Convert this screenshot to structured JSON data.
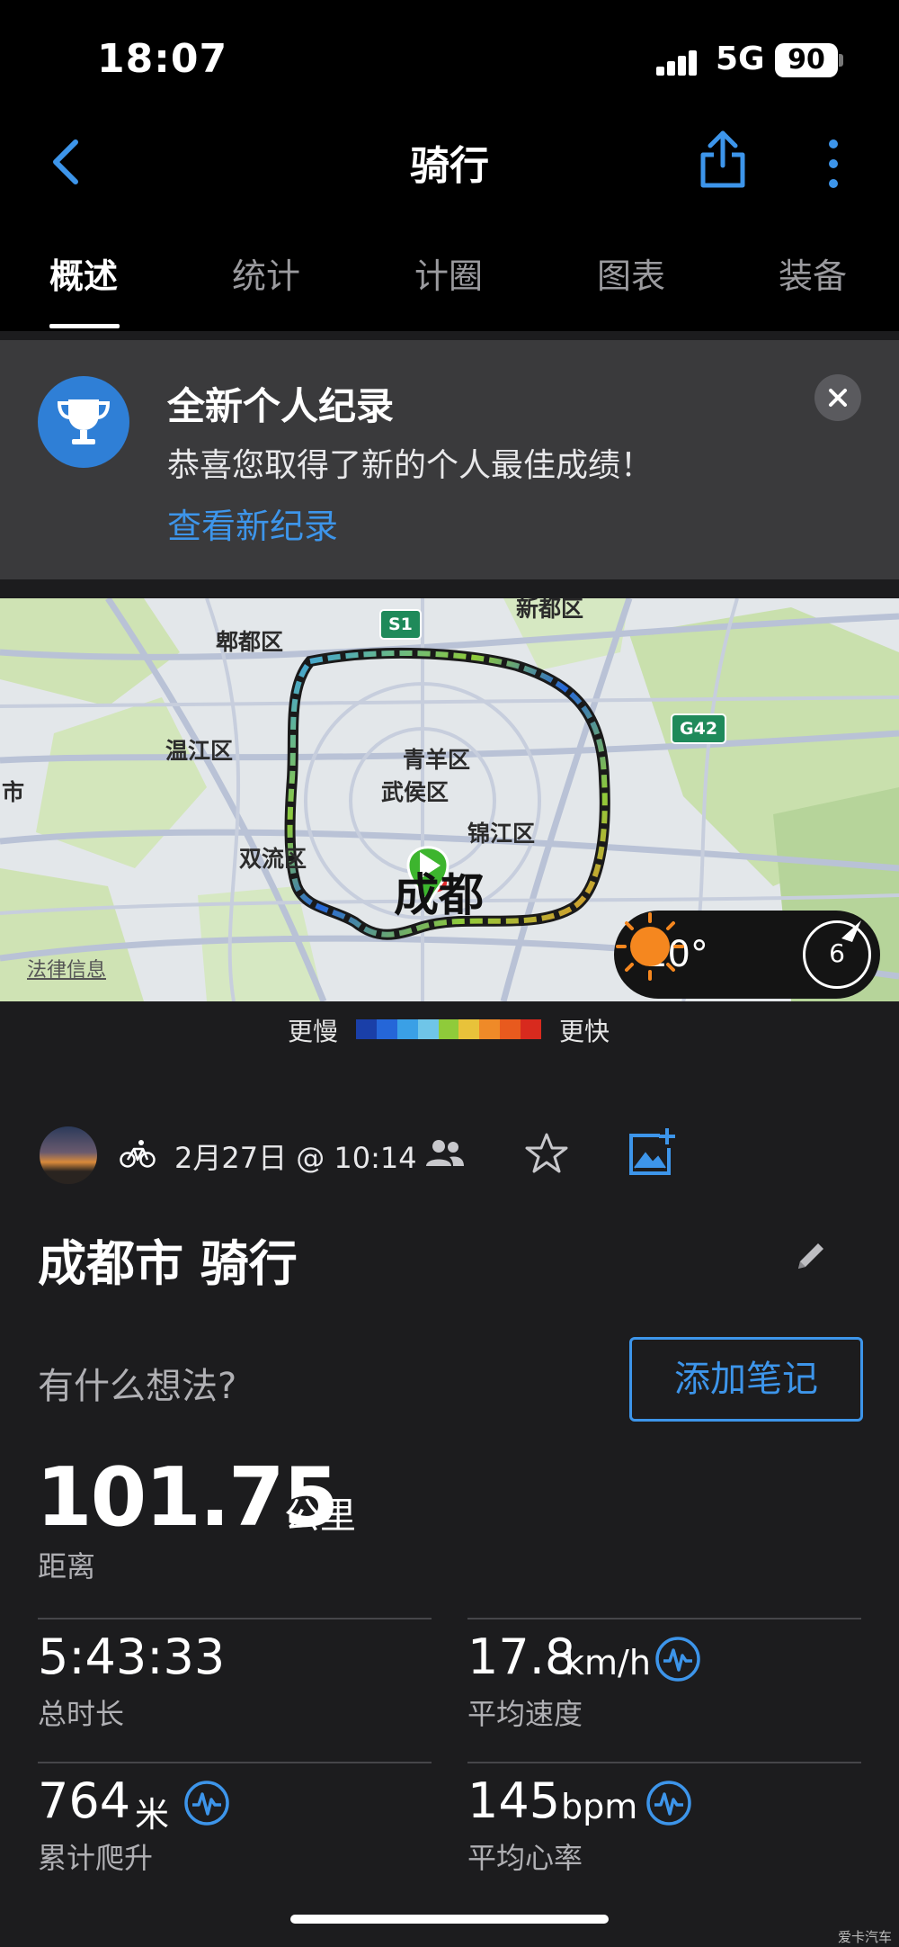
{
  "status_bar": {
    "time": "18:07",
    "network": "5G",
    "battery": "90"
  },
  "nav": {
    "title": "骑行"
  },
  "tabs": [
    "概述",
    "统计",
    "计圈",
    "图表",
    "装备"
  ],
  "record_banner": {
    "title": "全新个人纪录",
    "message": "恭喜您取得了新的个人最佳成绩！",
    "link": "查看新纪录"
  },
  "map": {
    "labels": [
      "新都区",
      "郫都区",
      "温江区",
      "青羊区",
      "武侯区",
      "锦江区",
      "双流区",
      "市"
    ],
    "city": "成都",
    "road_shields": [
      "S1",
      "G42"
    ],
    "legal_link": "法律信息",
    "weather": {
      "temperature": "10°",
      "condition_icon": "sun-icon",
      "wind": "6"
    }
  },
  "speed_legend": {
    "slow": "更慢",
    "fast": "更快",
    "colors": [
      "#1a3fa8",
      "#2566d8",
      "#3aa0e6",
      "#6fc5e8",
      "#8fcb3a",
      "#e8c23a",
      "#ef8a28",
      "#e85a1e",
      "#d82a1e"
    ]
  },
  "activity": {
    "date": "2月27日 @ 10:14",
    "title": "成都市 骑行",
    "thoughts_placeholder": "有什么想法?",
    "add_note": "添加笔记"
  },
  "stats": {
    "distance": {
      "value": "101.75",
      "unit": "公里",
      "label": "距离"
    },
    "duration": {
      "value": "5:43:33",
      "label": "总时长"
    },
    "avg_speed": {
      "value": "17.8",
      "unit": "km/h",
      "label": "平均速度"
    },
    "elevation": {
      "value": "764",
      "unit": "米",
      "label": "累计爬升"
    },
    "avg_hr": {
      "value": "145",
      "unit": "bpm",
      "label": "平均心率"
    }
  },
  "watermark": "爱卡汽车",
  "colors": {
    "accent": "#3d95ea",
    "background": "#1c1c1e",
    "route_green": "#3db52e"
  }
}
